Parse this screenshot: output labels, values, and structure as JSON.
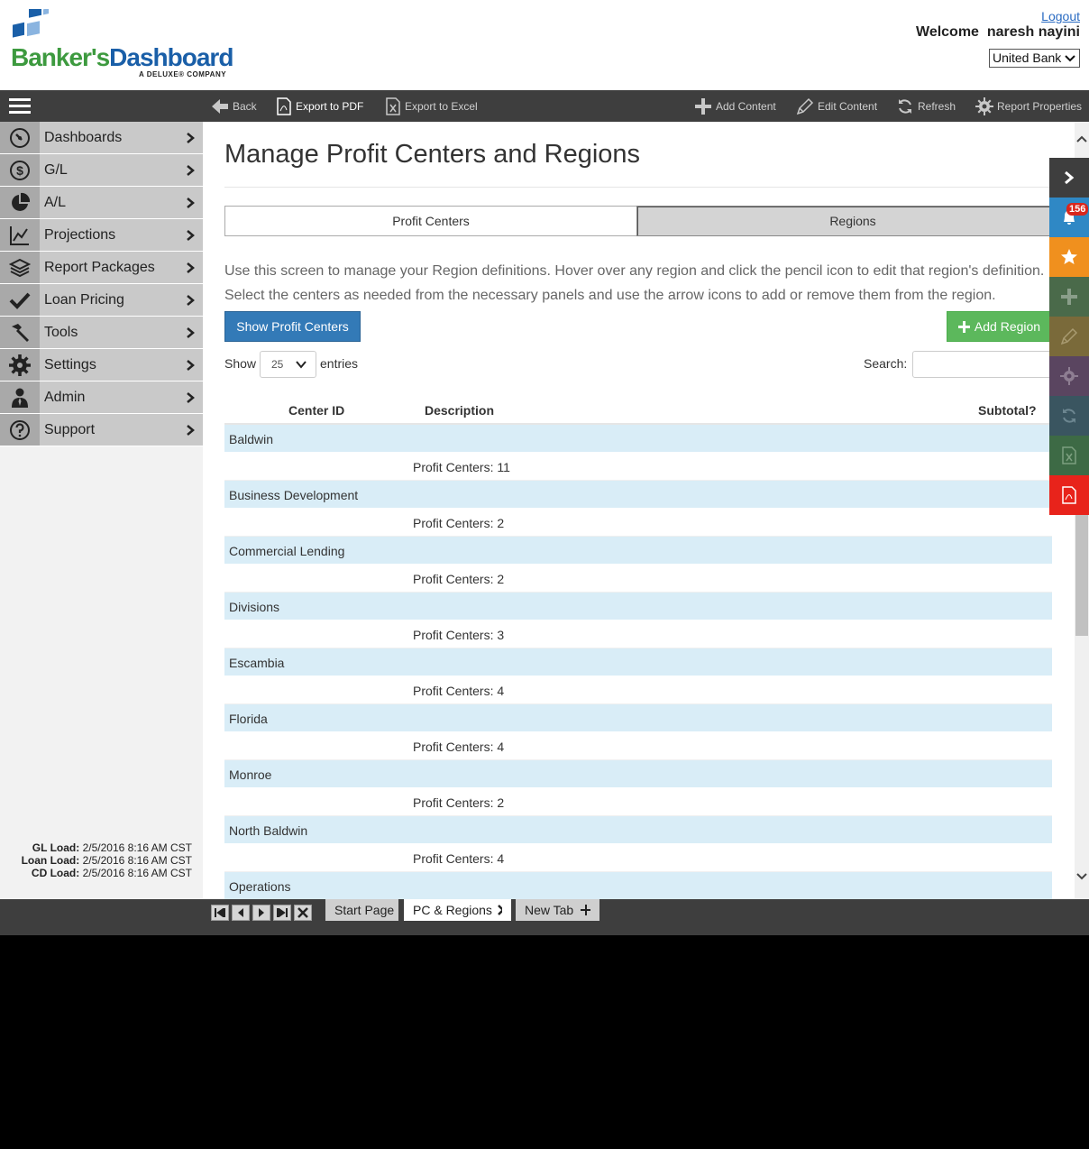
{
  "header": {
    "brand_part1": "Banker's",
    "brand_part2": "Dashboard",
    "brand_sub": "A DELUXE® COMPANY",
    "logout_label": "Logout",
    "welcome_text": "Welcome  naresh nayini",
    "bank_selected": "United Bank"
  },
  "toolbar": {
    "back": "Back",
    "export_pdf": "Export to PDF",
    "export_excel": "Export to Excel",
    "add_content": "Add Content",
    "edit_content": "Edit Content",
    "refresh": "Refresh",
    "report_properties": "Report Properties"
  },
  "sidebar": {
    "items": [
      {
        "label": "Dashboards",
        "icon": "dashboard-gauge-icon"
      },
      {
        "label": "G/L",
        "icon": "dollar-icon"
      },
      {
        "label": "A/L",
        "icon": "pie-chart-icon"
      },
      {
        "label": "Projections",
        "icon": "line-chart-icon"
      },
      {
        "label": "Report Packages",
        "icon": "layers-icon"
      },
      {
        "label": "Loan Pricing",
        "icon": "checkmark-icon"
      },
      {
        "label": "Tools",
        "icon": "hammer-icon"
      },
      {
        "label": "Settings",
        "icon": "gear-icon"
      },
      {
        "label": "Admin",
        "icon": "user-icon"
      },
      {
        "label": "Support",
        "icon": "question-icon"
      }
    ],
    "load_info": {
      "gl_label": "GL Load:",
      "gl_value": "2/5/2016 8:16 AM CST",
      "loan_label": "Loan Load:",
      "loan_value": "2/5/2016 8:16 AM CST",
      "cd_label": "CD Load:",
      "cd_value": "2/5/2016 8:16 AM CST"
    }
  },
  "main": {
    "title": "Manage Profit Centers and Regions",
    "tabs": {
      "profit_centers": "Profit Centers",
      "regions": "Regions"
    },
    "description": "Use this screen to manage your Region definitions. Hover over any region and click the pencil icon to edit that region's definition. Select the centers as needed from the necessary panels and use the arrow icons to add or remove them from the region.",
    "show_profit_centers_button": "Show Profit Centers",
    "add_region_button": "Add Region",
    "show_label": "Show",
    "entries_value": "25",
    "entries_label": "entries",
    "search_label": "Search:",
    "table": {
      "columns": {
        "center_id": "Center ID",
        "description": "Description",
        "subtotal": "Subtotal?"
      },
      "rows": [
        {
          "region": "Baldwin",
          "count": "Profit Centers: 11"
        },
        {
          "region": "Business Development",
          "count": "Profit Centers: 2"
        },
        {
          "region": "Commercial Lending",
          "count": "Profit Centers: 2"
        },
        {
          "region": "Divisions",
          "count": "Profit Centers: 3"
        },
        {
          "region": "Escambia",
          "count": "Profit Centers: 4"
        },
        {
          "region": "Florida",
          "count": "Profit Centers: 4"
        },
        {
          "region": "Monroe",
          "count": "Profit Centers: 2"
        },
        {
          "region": "North Baldwin",
          "count": "Profit Centers: 4"
        },
        {
          "region": "Operations",
          "count": ""
        }
      ]
    }
  },
  "right_strip": {
    "notification_count": "156",
    "colors": {
      "collapse": "#3e3e3e",
      "notifications": "#2f88c5",
      "favorite": "#f0901e",
      "add": "#4a6a4a",
      "edit": "#7a6a3a",
      "settings": "#5a4560",
      "refresh": "#3a5560",
      "excel": "#3d6a45",
      "pdf": "#e8231b"
    }
  },
  "tabbar": {
    "start_page": "Start Page",
    "current_tab": "PC & Regions",
    "new_tab": "New Tab"
  },
  "colors": {
    "brand_green": "#3d9a3f",
    "brand_blue": "#1a5fa8",
    "primary_button": "#337ab7",
    "success_button": "#5cb85c",
    "row_highlight": "#d9edf7"
  }
}
